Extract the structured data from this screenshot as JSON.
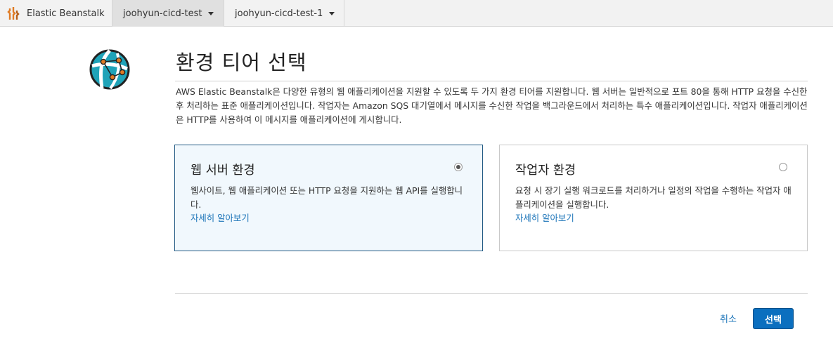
{
  "topbar": {
    "brand_label": "Elastic Beanstalk",
    "tabs": [
      {
        "label": "joohyun-cicd-test",
        "active": true
      },
      {
        "label": "joohyun-cicd-test-1",
        "active": false
      }
    ]
  },
  "page": {
    "title": "환경 티어 선택",
    "description": "AWS Elastic Beanstalk은 다양한 유형의 웹 애플리케이션을 지원할 수 있도록 두 가지 환경 티어를 지원합니다. 웹 서버는 일반적으로 포트 80을 통해 HTTP 요청을 수신한 후 처리하는 표준 애플리케이션입니다. 작업자는 Amazon SQS 대기열에서 메시지를 수신한 작업을 백그라운드에서 처리하는 특수 애플리케이션입니다. 작업자 애플리케이션은 HTTP를 사용하여 이 메시지를 애플리케이션에 게시합니다."
  },
  "tiers": [
    {
      "title": "웹 서버 환경",
      "description": "웹사이트, 웹 애플리케이션 또는 HTTP 요청을 지원하는 웹 API를 실행합니다.",
      "link": "자세히 알아보기",
      "selected": true
    },
    {
      "title": "작업자 환경",
      "description": "요청 시 장기 실행 워크로드를 처리하거나 일정의 작업을 수행하는 작업자 애플리케이션을 실행합니다.",
      "link": "자세히 알아보기",
      "selected": false
    }
  ],
  "actions": {
    "cancel_label": "취소",
    "select_label": "선택"
  },
  "colors": {
    "accent": "#0b6fbf",
    "link": "#1a73b8",
    "selected_card_bg": "#f1f8fd",
    "selected_card_border": "#225a84",
    "brand_orange": "#e07b24"
  },
  "icons": {
    "brand": "elastic-beanstalk-logo-icon",
    "hero": "environment-globe-icon",
    "tab_caret": "caret-down-icon"
  }
}
